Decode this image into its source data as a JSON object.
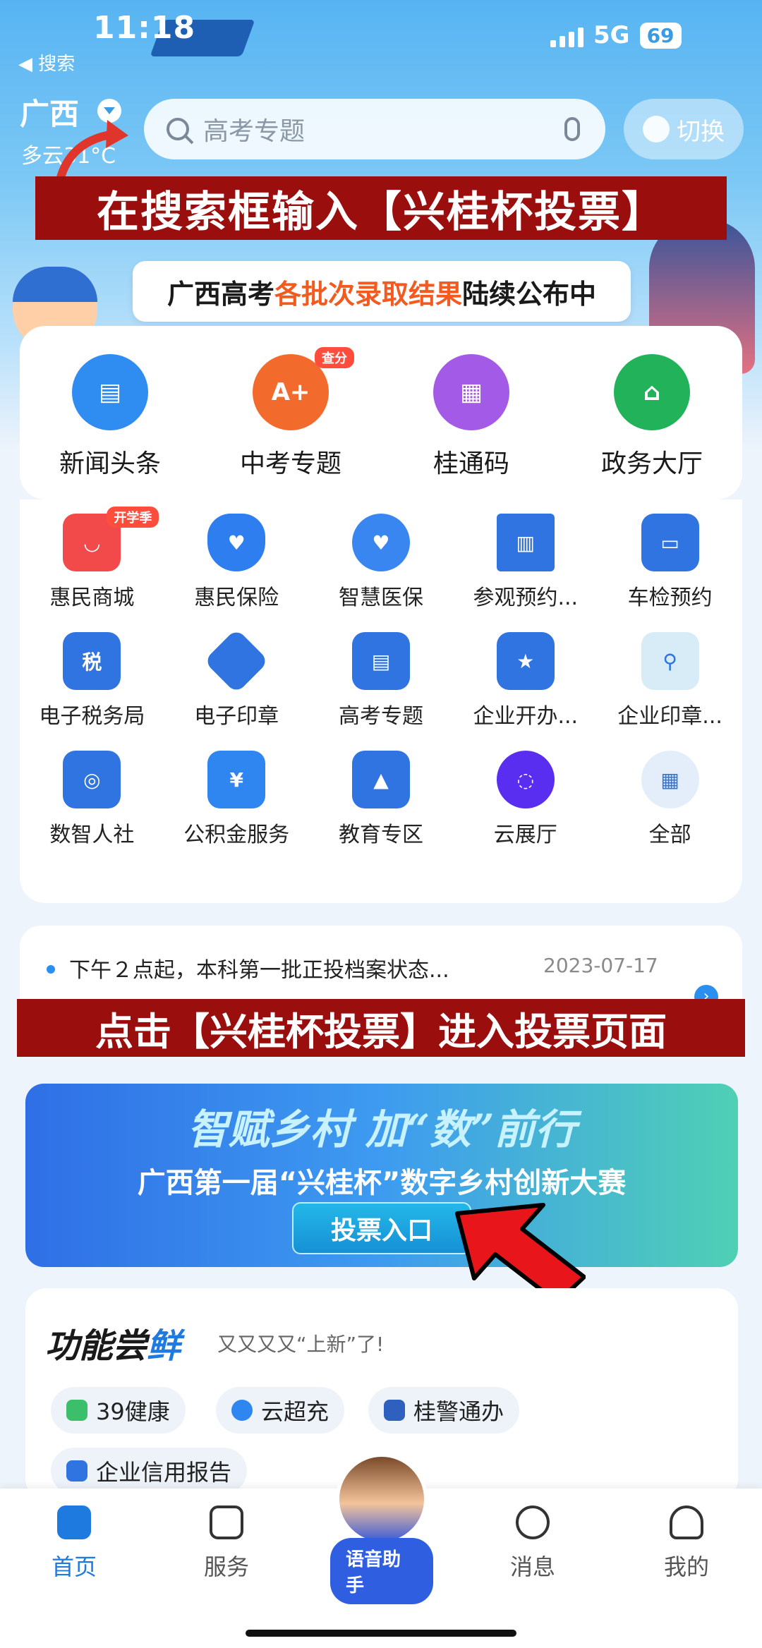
{
  "status": {
    "time": "11:18",
    "network": "5G",
    "battery": "69",
    "back_label": "◀ 搜索"
  },
  "header": {
    "city": "广西",
    "weather": "多云31°C",
    "search_placeholder": "高考专题",
    "switch_label": "切换"
  },
  "overlay": {
    "top_instruction": "在搜索框输入【兴桂杯投票】",
    "mid_instruction": "点击【兴桂杯投票】进入投票页面"
  },
  "announcement": {
    "prefix": "广西高考",
    "highlight": "各批次录取结果",
    "suffix": "陆续公布中"
  },
  "big_services": [
    {
      "label": "新闻头条",
      "icon": "news-icon",
      "color": "#2f8cf0"
    },
    {
      "label": "中考专题",
      "icon": "exam-icon",
      "color": "#f36b2c",
      "badge": "查分"
    },
    {
      "label": "桂通码",
      "icon": "qr-code-icon",
      "color": "#a35ae6"
    },
    {
      "label": "政务大厅",
      "icon": "government-hall-icon",
      "color": "#22b35a"
    }
  ],
  "small_services": [
    {
      "label": "惠民商城",
      "icon": "shopping-bag-icon",
      "color": "#f24a4a",
      "badge": "开学季"
    },
    {
      "label": "惠民保险",
      "icon": "shield-heart-icon",
      "color": "#2f7ef0"
    },
    {
      "label": "智慧医保",
      "icon": "hands-heart-icon",
      "color": "#3a86f0"
    },
    {
      "label": "参观预约...",
      "icon": "building-icon",
      "color": "#2f74e0"
    },
    {
      "label": "车检预约",
      "icon": "car-icon",
      "color": "#2f74e0"
    },
    {
      "label": "电子税务局",
      "icon": "tax-icon",
      "color": "#2f74e0",
      "glyph": "税"
    },
    {
      "label": "电子印章",
      "icon": "seal-icon",
      "color": "#2f74e0"
    },
    {
      "label": "高考专题",
      "icon": "id-card-icon",
      "color": "#2f74e0"
    },
    {
      "label": "企业开办...",
      "icon": "enterprise-icon",
      "color": "#2f74e0"
    },
    {
      "label": "企业印章...",
      "icon": "search-seal-icon",
      "color": "#d8ecf8"
    },
    {
      "label": "数智人社",
      "icon": "social-security-icon",
      "color": "#2f74e0"
    },
    {
      "label": "公积金服务",
      "icon": "housing-fund-icon",
      "color": "#2f86f0",
      "glyph": "¥"
    },
    {
      "label": "教育专区",
      "icon": "graduation-cap-icon",
      "color": "#2f74e0"
    },
    {
      "label": "云展厅",
      "icon": "cloud-gallery-icon",
      "color": "#5a2ef0"
    },
    {
      "label": "全部",
      "icon": "all-apps-icon",
      "color": "#e4eefb"
    }
  ],
  "news": {
    "text": "下午２点起，本科第一批正投档案状态...",
    "date": "2023-07-17"
  },
  "promo": {
    "slogan": "智赋乡村 加“数”前行",
    "title": "广西第一届“兴桂杯”数字乡村创新大赛",
    "button": "投票入口"
  },
  "features": {
    "title_a": "功能尝",
    "title_b": "鲜",
    "subtitle": "又又又又“上新”了!",
    "chips": [
      {
        "label": "39健康",
        "icon": "health-icon",
        "color": "#3bbf6a"
      },
      {
        "label": "云超充",
        "icon": "cloud-charge-icon",
        "color": "#2f86f0"
      },
      {
        "label": "桂警通办",
        "icon": "police-badge-icon",
        "color": "#2f5fbf"
      },
      {
        "label": "企业信用报告",
        "icon": "credit-report-icon",
        "color": "#2f74e0"
      }
    ]
  },
  "tabbar": {
    "home": "首页",
    "service": "服务",
    "assistant": "语音助手",
    "message": "消息",
    "mine": "我的"
  }
}
